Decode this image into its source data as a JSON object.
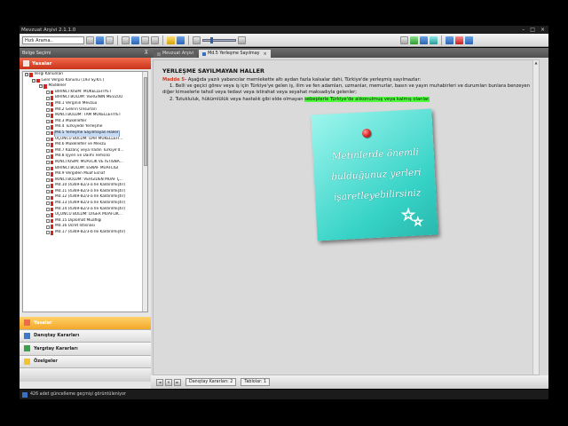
{
  "window": {
    "title": "Mevzuat Arşivi 2.1.1.0",
    "controls": [
      "–",
      "□",
      "×"
    ]
  },
  "toolbar": {
    "search_value": "Hızlı Arama.."
  },
  "left_panel": {
    "header": "Belge Seçimi",
    "pin": "⊼",
    "top_section": "Yasalar",
    "tree": [
      {
        "label": "Vergi Kanunları",
        "level": 0,
        "exp": "−"
      },
      {
        "label": "Gelir Vergisi Kanunu  (193 Sy.Kn.)",
        "level": 1,
        "exp": "−"
      },
      {
        "label": "Maddeler",
        "level": 2,
        "exp": "−"
      },
      {
        "label": "BİRİNCİ KISIM: MÜKELLEFİYET",
        "level": 3
      },
      {
        "label": "BİRİNCİ BÖLÜM: VERGİNİN MEVZUU",
        "level": 3
      },
      {
        "label": "Md.1 Verginin Mevzuu",
        "level": 3
      },
      {
        "label": "Md.2 Gelirin Unsurları",
        "level": 3
      },
      {
        "label": "İKİNCİ BÖLÜM: TAM MÜKELLEFİYET",
        "level": 3
      },
      {
        "label": "Md.3 Mükellefler",
        "level": 3
      },
      {
        "label": "Md.4 Türkiyede Yerleşme",
        "level": 3
      },
      {
        "label": "Md.5 Yerleşme Sayılmayan Haller",
        "level": 3,
        "selected": true
      },
      {
        "label": "ÜÇÜNCÜ BÖLÜM: DAR MÜKELLEFİ...",
        "level": 3
      },
      {
        "label": "Md.6 Mükellefler ve Mevzu",
        "level": 3
      },
      {
        "label": "Md.7 Kazanç veya İradın Türkiye'd...",
        "level": 3
      },
      {
        "label": "Md.8 İşyeri ve Daimi Temsilci",
        "level": 3
      },
      {
        "label": "İKİNCİ KISIM: MUAFLIK VE İSTİSNA...",
        "level": 3
      },
      {
        "label": "BİRİNCİ BÖLÜM: ESNAF MUAFLIĞI",
        "level": 3
      },
      {
        "label": "Md.9 Vergiden Muaf Esnaf",
        "level": 3
      },
      {
        "label": "İKİNCİ BÖLÜM: VERGİDEN MUAF Ç...",
        "level": 3
      },
      {
        "label": "Md.10 (4369-82/3-a İle Kaldırılmıştır)",
        "level": 3
      },
      {
        "label": "Md.11 (4369-82/3-a İle Kaldırılmıştır)",
        "level": 3
      },
      {
        "label": "Md.12 (4369-82/3-a İle Kaldırılmıştır)",
        "level": 3
      },
      {
        "label": "Md.13 (4369-82/3-a İle Kaldırılmıştır)",
        "level": 3
      },
      {
        "label": "Md.14 (4369-82/3-a İle Kaldırılmıştır)",
        "level": 3
      },
      {
        "label": "ÜÇÜNCÜ BÖLÜM: DİĞER MUAFLIK...",
        "level": 3
      },
      {
        "label": "Md.15 Diplomat Muaflığı",
        "level": 3
      },
      {
        "label": "Md.16 Ücret İstisnası",
        "level": 3
      },
      {
        "label": "Md.17 (4369-82/3-b İle Kaldırılmıştır)",
        "level": 3
      }
    ],
    "sections": [
      {
        "label": "Yasalar",
        "color": "#f26a4c",
        "active": true
      },
      {
        "label": "Danıştay Kararları",
        "color": "#3f78c9"
      },
      {
        "label": "Yargıtay Kararları",
        "color": "#3aa24a"
      },
      {
        "label": "Özelgeler",
        "color": "#f1c232"
      }
    ]
  },
  "main": {
    "tabs": [
      {
        "label": "Mevzuat Arşivi",
        "active": false
      },
      {
        "label": "Md.5 Yerleşme Sayılmay",
        "active": true,
        "close": "×"
      }
    ],
    "doc": {
      "title": "YERLEŞME SAYILMAYAN HALLER",
      "madde": "Madde 5-",
      "intro": " Aşağıda yazılı yabancılar memlekette altı aydan fazla kalsalar dahi, Türkiye'de yerleşmiş sayılmazlar:",
      "p1": "1. Belli ve geçici görev veya iş için Türkiye'ye gelen iş, ilim ve fen adamları, uzmanlar, memurlar, basın ve yayın muhabirleri ve durumları bunlara benzeyen diğer kimselerle tahsil veya tedavi veya istirahat veya seyahat maksadıyla gelenler;",
      "p2_pre": "2. Tutukluluk, hükümlülük veya hastalık gibi elde olmayan ",
      "p2_hl": "sebeplerle Türkiye'de alıkonulmuş veya kalmış olanlar."
    },
    "note": {
      "line1": "Metinlerde önemli",
      "line2": "bulduğunuz yerleri",
      "line3": "işaretleyebilirsiniz",
      "bg": "#35d2c6"
    },
    "bottom": {
      "nav": [
        "◄",
        "✕",
        "►"
      ],
      "tab1": "Danıştay Kararları: 2",
      "tab2": "Tablolar: 1"
    }
  },
  "status": {
    "text": "426 adet güncelleme geçmişi görüntüleniyor"
  }
}
